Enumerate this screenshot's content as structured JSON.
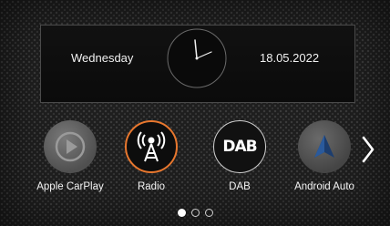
{
  "clock": {
    "day": "Wednesday",
    "date": "18.05.2022"
  },
  "apps": [
    {
      "label": "Apple CarPlay",
      "icon": "carplay-icon"
    },
    {
      "label": "Radio",
      "icon": "radio-tower-icon",
      "selected": true
    },
    {
      "label": "DAB",
      "icon": "dab-icon",
      "icon_text": "DAB"
    },
    {
      "label": "Android Auto",
      "icon": "android-auto-icon"
    }
  ],
  "pager": {
    "pages": 3,
    "current_page": 1
  },
  "colors": {
    "accent": "#e8772e",
    "text": "#ffffff",
    "panel_border": "#4a4a4a"
  }
}
